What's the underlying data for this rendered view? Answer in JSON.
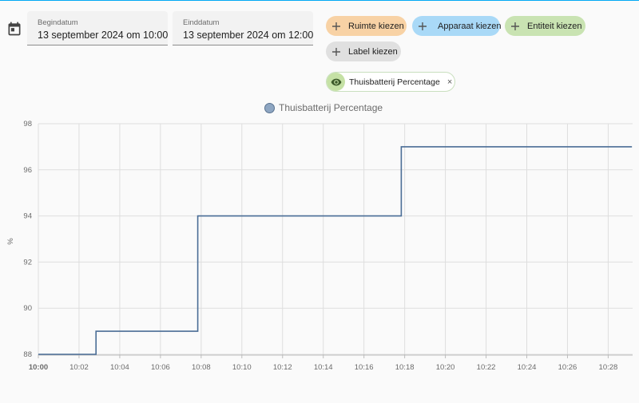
{
  "date_range": {
    "start": {
      "label": "Begindatum",
      "value": "13 september 2024 om 10:00"
    },
    "end": {
      "label": "Einddatum",
      "value": "13 september 2024 om 12:00"
    }
  },
  "target_picker": {
    "chips": [
      {
        "label": "Ruimte kiezen",
        "color": "#f8d2a5",
        "icon": "plus-icon"
      },
      {
        "label": "Apparaat kiezen",
        "color": "#a9d9f7",
        "icon": "plus-icon"
      },
      {
        "label": "Entiteit kiezen",
        "color": "#c9e3b2",
        "icon": "plus-icon"
      },
      {
        "label": "Label kiezen",
        "color": "#e0e0e0",
        "icon": "plus-icon"
      }
    ],
    "selected_entity": {
      "label": "Thuisbatterij Percentage",
      "icon": "eye-icon",
      "close": "×"
    }
  },
  "chart_data": {
    "type": "line",
    "step": true,
    "legend": {
      "entries": [
        "Thuisbatterij Percentage"
      ],
      "placement": "top-center"
    },
    "ylabel": "%",
    "ylim": [
      88,
      98
    ],
    "yticks": [
      "88",
      "90",
      "92",
      "94",
      "96",
      "98"
    ],
    "xlim_minutes": [
      0,
      29.2
    ],
    "xticks": [
      "10:00",
      "10:02",
      "10:04",
      "10:06",
      "10:08",
      "10:10",
      "10:12",
      "10:14",
      "10:16",
      "10:18",
      "10:20",
      "10:22",
      "10:24",
      "10:26",
      "10:28"
    ],
    "series": [
      {
        "name": "Thuisbatterij Percentage",
        "color": "#4a6d96",
        "x": [
          "10:00",
          "10:02:50",
          "10:07:50",
          "10:17:50",
          "10:29:10"
        ],
        "values": [
          88,
          89,
          94,
          97,
          97
        ]
      }
    ],
    "grid": true
  },
  "colors": {
    "accent": "#03a9f4",
    "series_line": "#4a6d96"
  }
}
